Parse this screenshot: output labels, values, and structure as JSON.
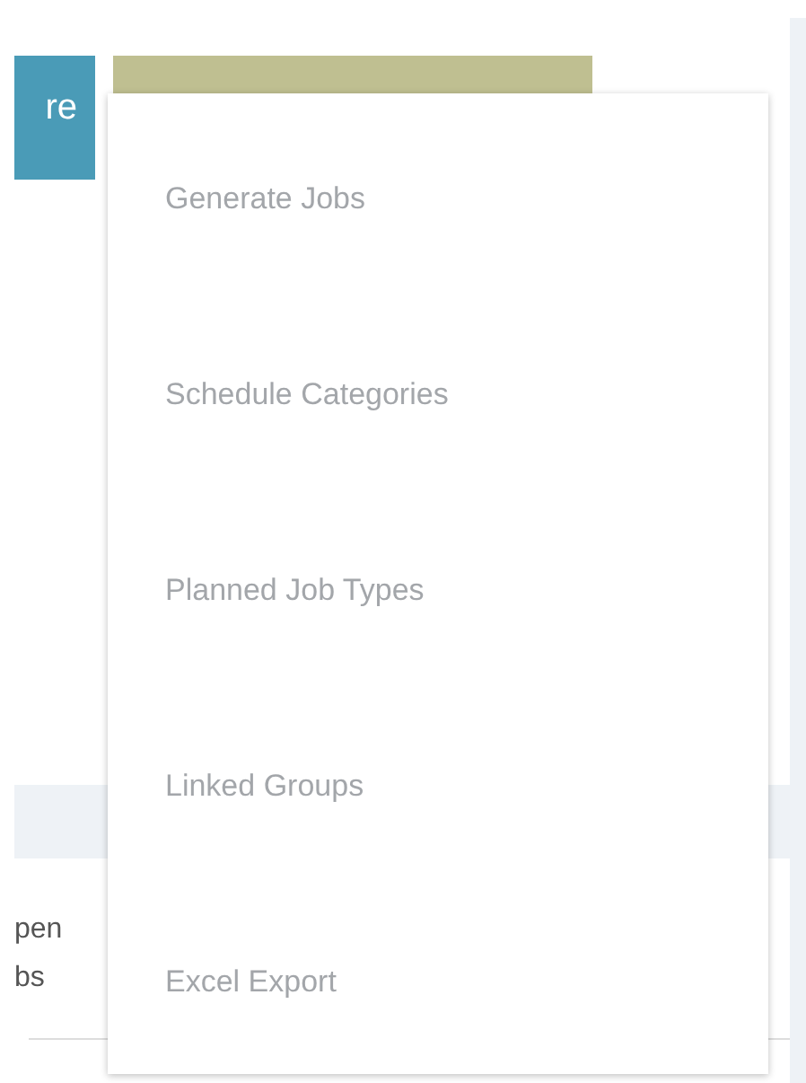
{
  "toolbar": {
    "button_label": "re"
  },
  "menu": {
    "items": [
      {
        "label": "Generate Jobs"
      },
      {
        "label": "Schedule Categories"
      },
      {
        "label": "Planned Job Types"
      },
      {
        "label": "Linked Groups"
      },
      {
        "label": "Excel Export"
      }
    ]
  },
  "table": {
    "column_header": "pen bs"
  }
}
